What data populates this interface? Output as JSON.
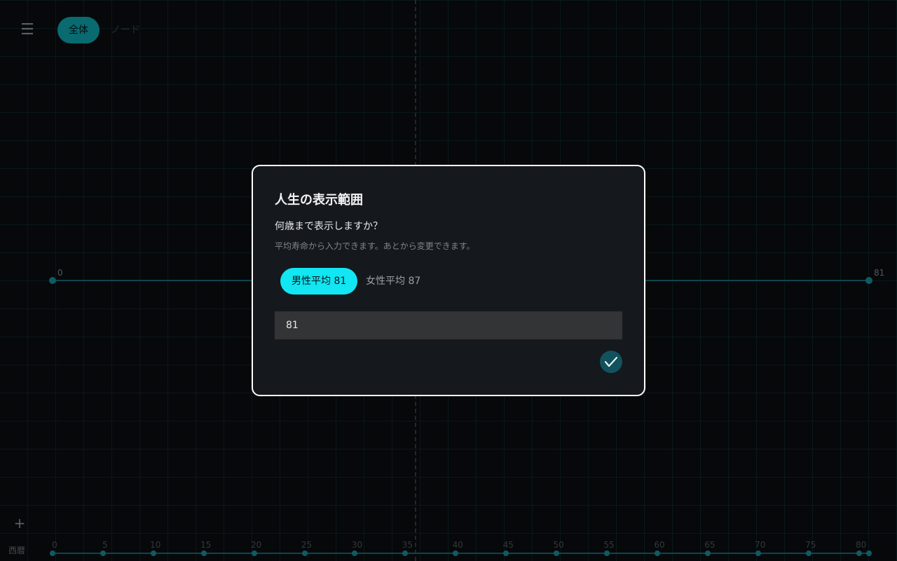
{
  "header": {
    "tabs": [
      {
        "label": "全体",
        "active": true
      },
      {
        "label": "ノード",
        "active": false
      }
    ]
  },
  "lifespan": {
    "start_label": "0",
    "end_label": "81"
  },
  "modal": {
    "title": "人生の表示範囲",
    "question": "何歳まで表示しますか？",
    "hint": "平均寿命から入力できます。あとから変更できます。",
    "presets": [
      {
        "label": "男性平均 81",
        "value": 81,
        "selected": true
      },
      {
        "label": "女性平均 87",
        "value": 87,
        "selected": false
      }
    ],
    "age_value": "81",
    "confirm_icon": "check-icon"
  },
  "bottom_axis": {
    "label": "西暦",
    "ticks": [
      "0",
      "5",
      "10",
      "15",
      "20",
      "25",
      "30",
      "35",
      "40",
      "45",
      "50",
      "55",
      "60",
      "65",
      "70",
      "75",
      "80"
    ],
    "max_age": 81
  },
  "icons": {
    "menu": "hamburger-icon",
    "add": "plus-icon"
  },
  "colors": {
    "accent": "#11e6f2",
    "accent_dark": "#0fa3ad",
    "line": "#136a78",
    "background": "#0b0d10",
    "modal_bg": "#15181d"
  }
}
